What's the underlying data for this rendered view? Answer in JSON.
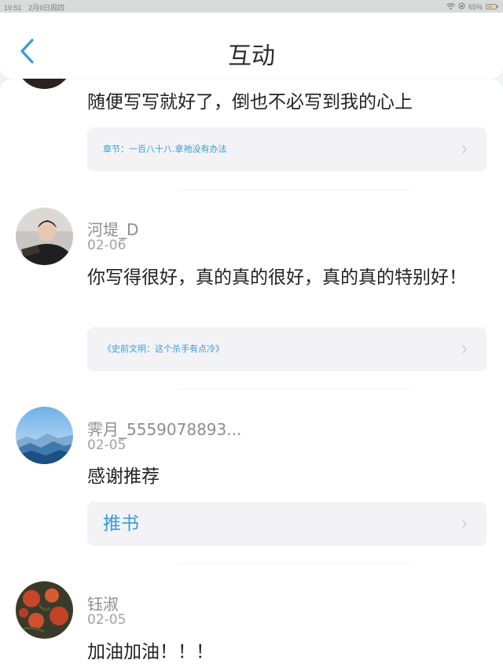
{
  "status_bar": {
    "time": "19:51",
    "date": "2月9日周四",
    "battery": "65%",
    "battery_level": 0.65
  },
  "header": {
    "title": "互动"
  },
  "comments": [
    {
      "text": "随便写写就好了，倒也不必写到我的心上",
      "ref": "章节：一百八十八.拿祂没有办法"
    },
    {
      "name": "河堤_D",
      "date": "02-06",
      "text": "你写得很好，真的真的很好，真的真的特别好！",
      "ref": "《史前文明：这个杀手有点冷》"
    },
    {
      "name": "霁月_5559078893...",
      "date": "02-05",
      "text": "感谢推荐",
      "ref": "推书"
    },
    {
      "name": "钰淑",
      "date": "02-05",
      "text": "加油加油！！！"
    }
  ],
  "colors": {
    "accent": "#3a9bdc",
    "ref_bg": "#f3f3f5",
    "battery": "#f2b823"
  },
  "icons": {
    "back": "chevron-left-icon",
    "ref_arrow": "chevron-right-icon",
    "wifi": "wifi-icon"
  }
}
